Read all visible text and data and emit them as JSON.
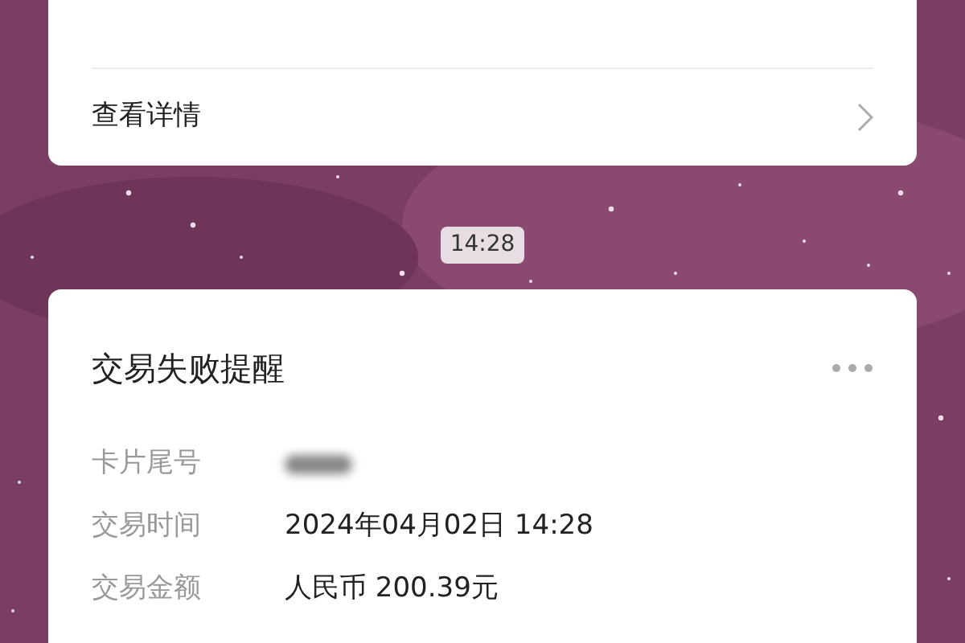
{
  "previous_card": {
    "link": "查看详情"
  },
  "timestamp": "14:28",
  "card": {
    "title": "交易失败提醒",
    "fields": [
      {
        "label": "卡片尾号",
        "kind": "redacted"
      },
      {
        "label": "交易时间",
        "kind": "text",
        "value": "2024年04月02日 14:28"
      },
      {
        "label": "交易金额",
        "kind": "text",
        "value": "人民币 200.39元"
      }
    ]
  }
}
